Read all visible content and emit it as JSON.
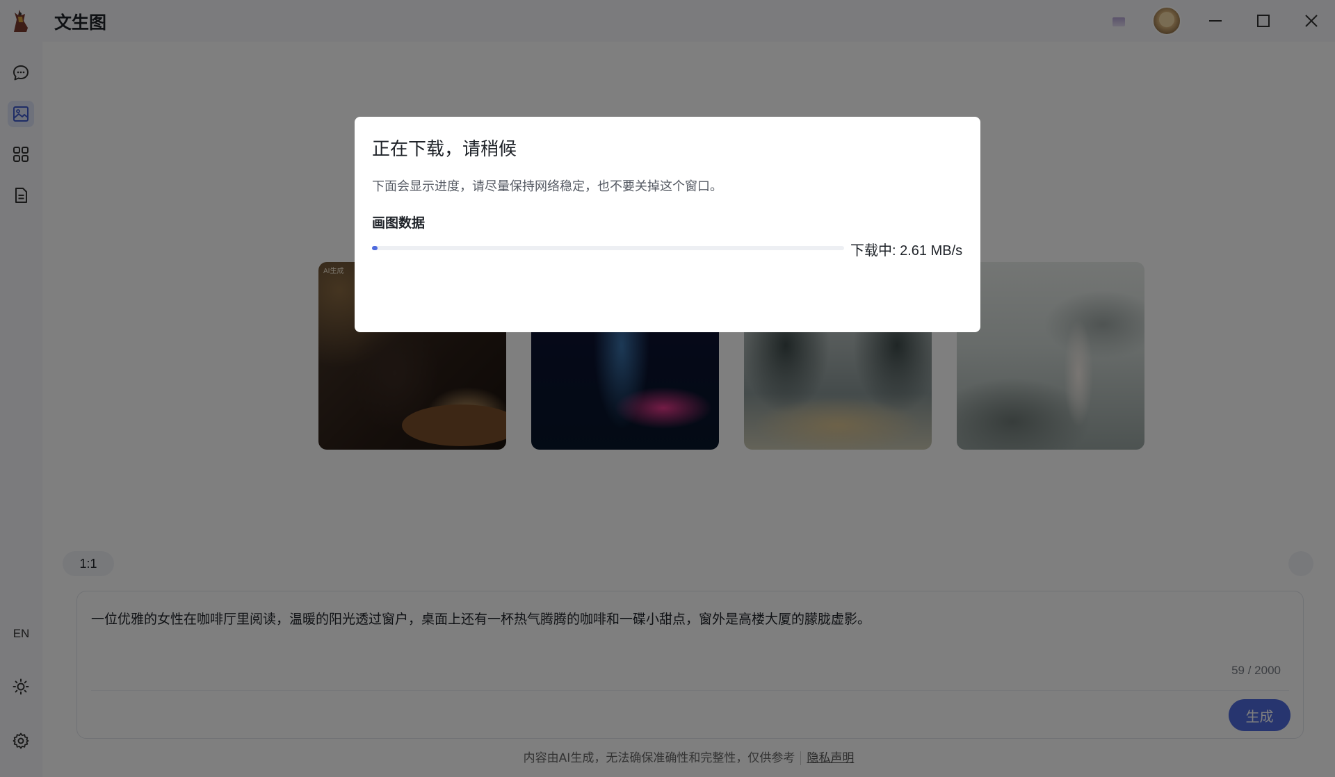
{
  "app": {
    "title": "文生图"
  },
  "sidebar": {
    "items": [
      {
        "name": "chat",
        "icon": "chat-bubble-icon"
      },
      {
        "name": "text-to-image",
        "icon": "image-icon",
        "active": true
      },
      {
        "name": "apps",
        "icon": "grid-icon"
      },
      {
        "name": "documents",
        "icon": "document-icon"
      }
    ],
    "language_label": "EN"
  },
  "examples": {
    "card_1_tag": "AI生成"
  },
  "controls": {
    "aspect_ratio": "1:1"
  },
  "prompt": {
    "text": "一位优雅的女性在咖啡厅里阅读，温暖的阳光透过窗户，桌面上还有一杯热气腾腾的咖啡和一碟小甜点，窗外是高楼大厦的朦胧虚影。",
    "char_count": "59 / 2000",
    "generate_label": "生成"
  },
  "footer": {
    "disclaimer": "内容由AI生成，无法确保准确性和完整性，仅供参考",
    "privacy_link": "隐私声明"
  },
  "dialog": {
    "title": "正在下载，请稍候",
    "description": "下面会显示进度，请尽量保持网络稳定，也不要关掉这个窗口。",
    "item_label": "画图数据",
    "progress_fraction": 0.012,
    "status_text": "下载中: 2.61 MB/s"
  },
  "colors": {
    "accent": "#4f6bde",
    "overlay": "rgba(0,0,0,0.5)"
  }
}
